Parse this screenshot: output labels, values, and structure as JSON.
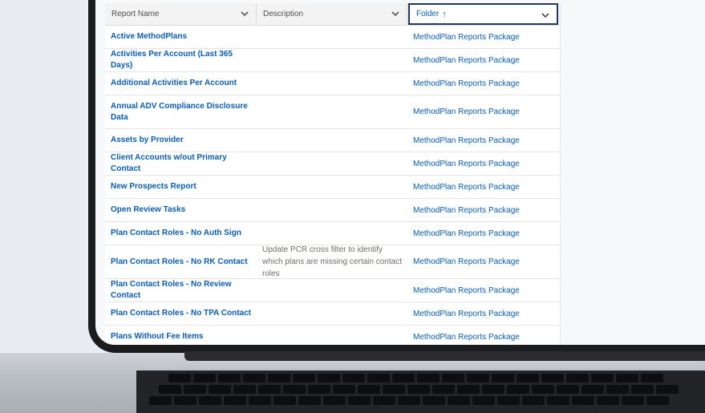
{
  "table": {
    "headers": {
      "report_name": "Report Name",
      "description": "Description",
      "folder": "Folder",
      "folder_sort": "↑"
    },
    "rows": [
      {
        "name": "Active MethodPlans",
        "description": "",
        "folder": "MethodPlan Reports Package"
      },
      {
        "name": "Activities Per Account (Last 365 Days)",
        "description": "",
        "folder": "MethodPlan Reports Package"
      },
      {
        "name": "Additional Activities Per Account",
        "description": "",
        "folder": "MethodPlan Reports Package"
      },
      {
        "name": "Annual ADV Compliance Disclosure Data",
        "description": "",
        "folder": "MethodPlan Reports Package"
      },
      {
        "name": "Assets by Provider",
        "description": "",
        "folder": "MethodPlan Reports Package"
      },
      {
        "name": "Client Accounts w/out Primary Contact",
        "description": "",
        "folder": "MethodPlan Reports Package"
      },
      {
        "name": "New Prospects Report",
        "description": "",
        "folder": "MethodPlan Reports Package"
      },
      {
        "name": "Open Review Tasks",
        "description": "",
        "folder": "MethodPlan Reports Package"
      },
      {
        "name": "Plan Contact Roles - No Auth Sign",
        "description": "",
        "folder": "MethodPlan Reports Package"
      },
      {
        "name": "Plan Contact Roles - No RK Contact",
        "description": "Update PCR cross filter to identify which plans are missing certain contact roles",
        "folder": "MethodPlan Reports Package"
      },
      {
        "name": "Plan Contact Roles - No Review Contact",
        "description": "",
        "folder": "MethodPlan Reports Package"
      },
      {
        "name": "Plan Contact Roles - No TPA Contact",
        "description": "",
        "folder": "MethodPlan Reports Package"
      },
      {
        "name": "Plans Without Fee Items",
        "description": "",
        "folder": "MethodPlan Reports Package"
      }
    ]
  }
}
